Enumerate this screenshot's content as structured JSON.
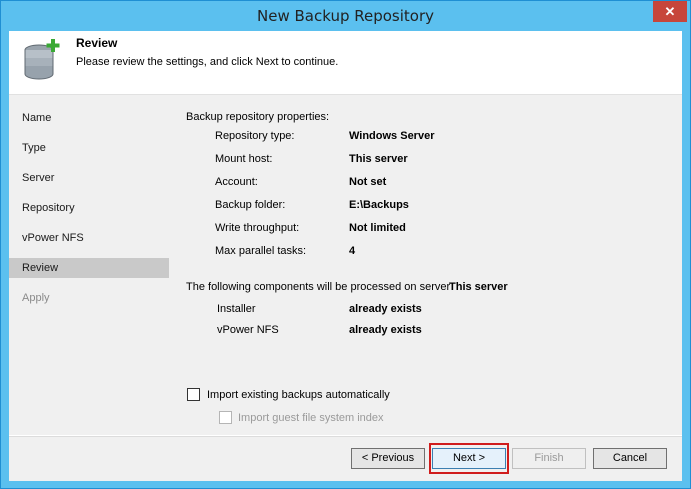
{
  "window": {
    "title": "New Backup Repository",
    "close_glyph": "✕"
  },
  "header": {
    "title": "Review",
    "description": "Please review the settings, and click Next to continue.",
    "icon": "database-add-icon"
  },
  "sidebar": {
    "items": [
      {
        "label": "Name",
        "state": "normal"
      },
      {
        "label": "Type",
        "state": "normal"
      },
      {
        "label": "Server",
        "state": "normal"
      },
      {
        "label": "Repository",
        "state": "normal"
      },
      {
        "label": "vPower NFS",
        "state": "normal"
      },
      {
        "label": "Review",
        "state": "active"
      },
      {
        "label": "Apply",
        "state": "disabled"
      }
    ]
  },
  "properties": {
    "heading": "Backup repository properties:",
    "rows": [
      {
        "label": "Repository type:",
        "value": "Windows Server"
      },
      {
        "label": "Mount host:",
        "value": "This server"
      },
      {
        "label": "Account:",
        "value": "Not set"
      },
      {
        "label": "Backup folder:",
        "value": "E:\\Backups"
      },
      {
        "label": "Write throughput:",
        "value": "Not limited"
      },
      {
        "label": "Max parallel tasks:",
        "value": "4"
      }
    ]
  },
  "components": {
    "heading": "The following components will be processed on server",
    "server": "This server",
    "rows": [
      {
        "label": "Installer",
        "value": "already exists"
      },
      {
        "label": "vPower NFS",
        "value": "already exists"
      }
    ]
  },
  "options": {
    "import_backups": {
      "label": "Import existing backups automatically",
      "checked": false
    },
    "import_index": {
      "label": "Import guest file system index",
      "checked": false,
      "enabled": false
    }
  },
  "footer": {
    "previous": "< Previous",
    "next": "Next >",
    "finish": "Finish",
    "cancel": "Cancel"
  },
  "colors": {
    "titlebar": "#5bc0ef",
    "close": "#c7463b",
    "highlight": "#d01c1c",
    "active_nav": "#c9c9c9"
  }
}
